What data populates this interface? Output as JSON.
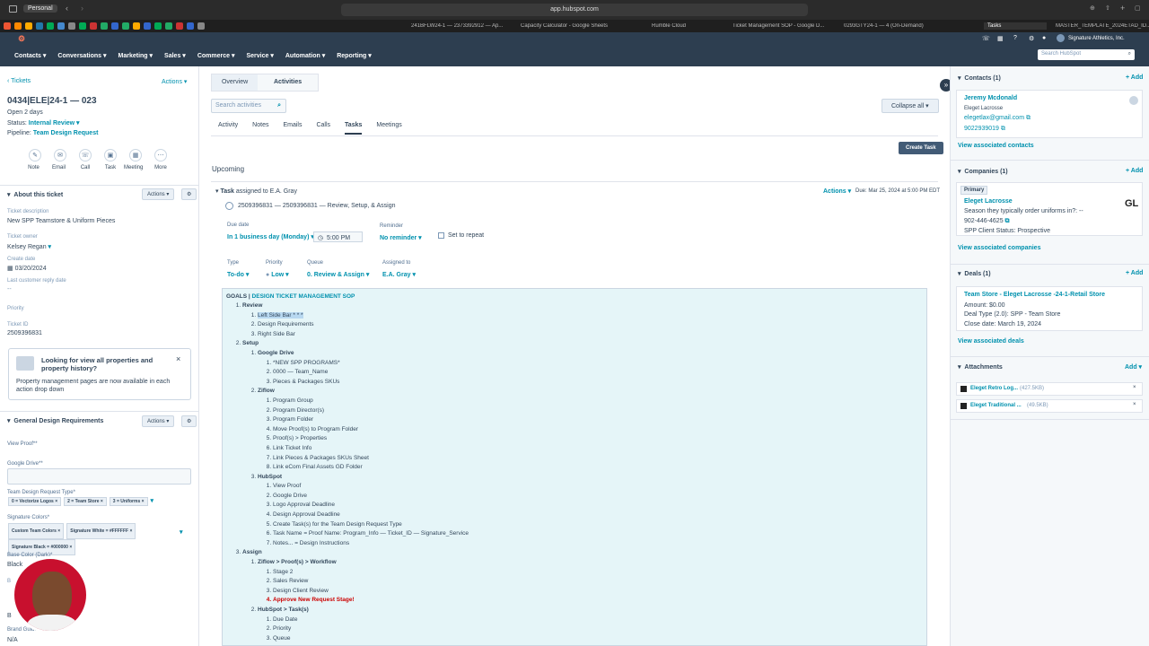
{
  "browser": {
    "profile": "Personal",
    "url": "app.hubspot.com"
  },
  "tabs": [
    "241BFLW24-1 — 2373392912 — Ap...",
    "Capacity Calculator - Google Sheets",
    "Rumble Cloud",
    "Ticket Management SOP - Google D...",
    "0293GTY24-1 — 4 (On-Demand)",
    "Tasks",
    "MASTER_TEMPLATE_2024ETAD_ID..."
  ],
  "nav": {
    "items": [
      "Contacts",
      "Conversations",
      "Marketing",
      "Sales",
      "Commerce",
      "Service",
      "Automation",
      "Reporting"
    ],
    "account": "Signature Athletics, Inc.",
    "search_placeholder": "Search HubSpot"
  },
  "ticket": {
    "back": "Tickets",
    "actions": "Actions",
    "title": "0434|ELE|24-1 — 023",
    "open": "Open 2 days",
    "status_label": "Status:",
    "status": "Internal Review",
    "pipeline_label": "Pipeline:",
    "pipeline": "Team Design Request",
    "quick": [
      "Note",
      "Email",
      "Call",
      "Task",
      "Meeting",
      "More"
    ],
    "about": "About this ticket",
    "about_actions": "Actions",
    "desc_label": "Ticket description",
    "desc": "New SPP Teamstore & Uniform Pieces",
    "owner_label": "Ticket owner",
    "owner": "Kelsey Regan",
    "create_label": "Create date",
    "create": "03/20/2024",
    "reply_label": "Last customer reply date",
    "reply": "--",
    "priority_label": "Priority",
    "id_label": "Ticket ID",
    "id": "2509396831",
    "promo_title": "Looking for view all properties and property history?",
    "promo_body": "Property management pages are now available in each action drop down",
    "gdr": "General Design Requirements",
    "gdr_actions": "Actions",
    "view_proof": "View Proof**",
    "gdrive": "Google Drive**",
    "tdr_type": "Team Design Request Type*",
    "tdr_tags": [
      "0 = Vectorize Logos",
      "2 = Team Store",
      "3 = Uniforms"
    ],
    "sig_colors": "Signature Colors*",
    "color_tags": [
      "Custom Team Colors",
      "Signature White = #FFFFFF",
      "Signature Black = #000000"
    ],
    "base_color": "Base Color (Dark)*",
    "base_val": "Black",
    "brand": "Brand Guidelines",
    "brand_val": "N/A",
    "b_short": "B",
    "b_short2": "B"
  },
  "center": {
    "tabs": [
      "Overview",
      "Activities"
    ],
    "search_placeholder": "Search activities",
    "collapse": "Collapse all",
    "subtabs": [
      "Activity",
      "Notes",
      "Emails",
      "Calls",
      "Tasks",
      "Meetings"
    ],
    "create_task": "Create Task",
    "upcoming": "Upcoming",
    "task_head_bold": "Task",
    "task_head": " assigned to E.A. Gray",
    "task_actions": "Actions",
    "due_info": "Due: Mar 25, 2024 at 5:00 PM EDT",
    "task_title": "2509396831 — 2509396831 — Review, Setup, & Assign",
    "due_label": "Due date",
    "due_val": "In 1 business day (Monday)",
    "time": "5:00 PM",
    "reminder_label": "Reminder",
    "reminder": "No reminder",
    "repeat": "Set to repeat",
    "type_label": "Type",
    "type": "To-do",
    "priority_label": "Priority",
    "priority": "Low",
    "queue_label": "Queue",
    "queue": "0. Review & Assign",
    "assigned_label": "Assigned to",
    "assigned": "E.A. Gray",
    "goals_prefix": "GOALS | ",
    "goals_link": "DESIGN TICKET MANAGEMENT SOP",
    "review": "Review",
    "review_items": [
      "Left Side Bar * * *",
      "Design Requirements",
      "Right Side Bar"
    ],
    "setup": "Setup",
    "gdrive": "Google Drive",
    "gdrive_items": [
      "*NEW SPP PROGRAMS*",
      "0000 — Team_Name",
      "Pieces & Packages SKUs"
    ],
    "ziflow": "Ziflow",
    "ziflow_items": [
      "Program Group",
      "Program Director(s)",
      "Program Folder",
      "Move Proof(s) to Program Folder",
      "Proof(s) > Properties",
      "Link Ticket Info",
      "Link Pieces & Packages SKUs Sheet",
      "Link eCom Final Assets GD Folder"
    ],
    "hubspot": "HubSpot",
    "hubspot_items": [
      "View Proof",
      "Google Drive",
      "Logo Approval Deadline",
      "Design Approval Deadline",
      "Create Task(s) for the Team Design Request Type",
      "Task Name = Proof Name: Program_Info — Ticket_ID — Signature_Service",
      "Notes... = Design Instructions"
    ],
    "assign": "Assign",
    "zwf": "Ziflow > Proof(s) > Workflow",
    "zwf_items": [
      "Stage 2",
      "Sales Review",
      "Design Client Review"
    ],
    "zwf_red": "Approve New Request Stage!",
    "hst": "HubSpot > Task(s)",
    "hst_items": [
      "Due Date",
      "Priority",
      "Queue"
    ]
  },
  "right": {
    "contacts": "Contacts (1)",
    "add": "+ Add",
    "contact_name": "Jeremy Mcdonald",
    "contact_co": "Eleget Lacrosse",
    "contact_email": "elegetlax@gmail.com",
    "contact_phone": "9022939019",
    "view_contacts": "View associated contacts",
    "companies": "Companies (1)",
    "primary": "Primary",
    "company": "Eleget Lacrosse",
    "company_q": "Season they typically order uniforms in?: --",
    "company_phone": "902-446-4625",
    "company_status": "SPP Client Status:  Prospective",
    "company_logo": "GL",
    "view_companies": "View associated companies",
    "deals": "Deals (1)",
    "deal_name": "Team Store - Eleget Lacrosse -24-1-Retail Store",
    "deal_amount": "Amount: $0.00",
    "deal_type": "Deal Type (2.0):  SPP - Team Store",
    "deal_close": "Close date: March 19, 2024",
    "view_deals": "View associated deals",
    "attachments": "Attachments",
    "att_add": "Add",
    "files": [
      {
        "name": "Eleget Retro Log...",
        "size": "(427.5KB)"
      },
      {
        "name": "Eleget Traditional ...",
        "size": "(49.5KB)"
      }
    ]
  },
  "colors": {
    "nav": "#2d3e50",
    "link": "#0091ae",
    "editor": "#e5f5f8"
  }
}
